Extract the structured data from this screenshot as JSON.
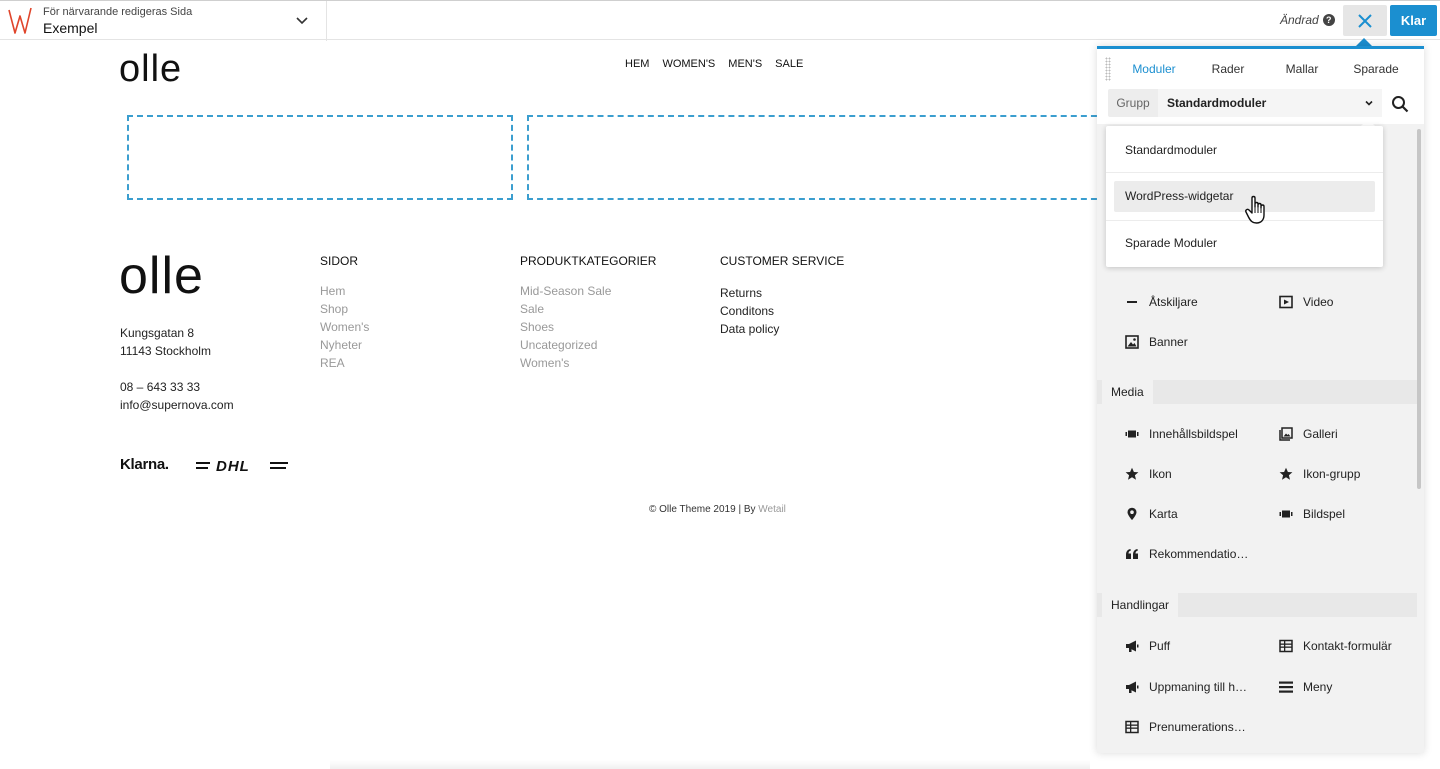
{
  "topbar": {
    "context_label": "För närvarande redigeras Sida",
    "page_title": "Exempel",
    "status": "Ändrad",
    "help": "?",
    "done_label": "Klar",
    "colors": {
      "accent": "#1b8fd0",
      "logo": "#e0452b"
    }
  },
  "site": {
    "logo": "olle",
    "nav": [
      "HEM",
      "WOMEN'S",
      "MEN'S",
      "SALE"
    ],
    "footer": {
      "logo": "olle",
      "address_line1": "Kungsgatan 8",
      "address_line2": "11143 Stockholm",
      "phone": "08 – 643 33 33",
      "email": "info@supernova.com",
      "columns": [
        {
          "title": "SIDOR",
          "items": [
            "Hem",
            "Shop",
            "Women's",
            "Nyheter",
            "REA"
          ]
        },
        {
          "title": "PRODUKTKATEGORIER",
          "items": [
            "Mid-Season Sale",
            "Sale",
            "Shoes",
            "Uncategorized",
            "Women's"
          ]
        },
        {
          "title": "CUSTOMER SERVICE",
          "items": [
            "Returns",
            "Conditons",
            "Data policy"
          ]
        }
      ],
      "klarna": "Klarna.",
      "dhl": "DHL",
      "copyright": "© Olle Theme 2019 | By ",
      "copyright_link": "Wetail"
    }
  },
  "panel": {
    "tabs": [
      "Moduler",
      "Rader",
      "Mallar",
      "Sparade"
    ],
    "active_tab": "Moduler",
    "group_label": "Grupp",
    "group_value": "Standardmoduler",
    "dropdown": [
      "Standardmoduler",
      "WordPress-widgetar",
      "Sparade Moduler"
    ],
    "dropdown_highlight": "WordPress-widgetar",
    "basic_modules": [
      {
        "label": "Åtskiljare",
        "icon": "separator-icon"
      },
      {
        "label": "Video",
        "icon": "video-icon"
      },
      {
        "label": "Banner",
        "icon": "image-icon"
      }
    ],
    "media_title": "Media",
    "media_modules": [
      {
        "label": "Innehållsbildspel",
        "icon": "slideshow-icon"
      },
      {
        "label": "Galleri",
        "icon": "gallery-icon"
      },
      {
        "label": "Ikon",
        "icon": "star-icon"
      },
      {
        "label": "Ikon-grupp",
        "icon": "star-icon"
      },
      {
        "label": "Karta",
        "icon": "map-pin-icon"
      },
      {
        "label": "Bildspel",
        "icon": "slideshow-icon"
      },
      {
        "label": "Rekommendatio…",
        "icon": "quote-icon"
      }
    ],
    "actions_title": "Handlingar",
    "action_modules": [
      {
        "label": "Puff",
        "icon": "megaphone-icon"
      },
      {
        "label": "Kontakt-formulär",
        "icon": "form-icon"
      },
      {
        "label": "Uppmaning till h…",
        "icon": "megaphone-icon"
      },
      {
        "label": "Meny",
        "icon": "menu-icon"
      },
      {
        "label": "Prenumerations…",
        "icon": "form-icon"
      }
    ]
  }
}
